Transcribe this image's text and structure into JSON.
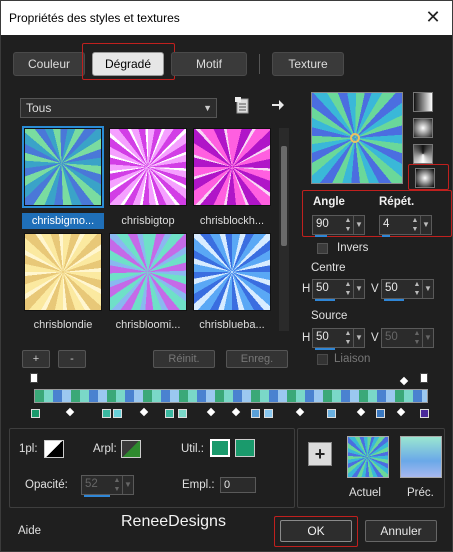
{
  "window": {
    "title": "Propriétés des styles et textures",
    "close_glyph": "✕"
  },
  "tabs": [
    {
      "label": "Couleur",
      "active": false
    },
    {
      "label": "Dégradé",
      "active": true
    },
    {
      "label": "Motif",
      "active": false
    },
    {
      "label": "Texture",
      "active": false
    }
  ],
  "library": {
    "category_selected": "Tous",
    "thumbnails": [
      {
        "label": "chrisbigmo...",
        "selected": true
      },
      {
        "label": "chrisbigtop",
        "selected": false
      },
      {
        "label": "chrisblockh...",
        "selected": false
      },
      {
        "label": "chrisblondie",
        "selected": false
      },
      {
        "label": "chrisbloomi...",
        "selected": false
      },
      {
        "label": "chrisblueba...",
        "selected": false
      }
    ],
    "buttons": {
      "add": "+",
      "remove": "-",
      "reset": "Réinit.",
      "save": "Enreg."
    }
  },
  "style": {
    "angle_label": "Angle",
    "angle_value": "90",
    "repeat_label": "Répét.",
    "repeat_value": "4",
    "invert_label": "Invers",
    "center_label": "Centre",
    "center_h_label": "H",
    "center_h_value": "50",
    "center_v_label": "V",
    "center_v_value": "50",
    "source_label": "Source",
    "source_h_label": "H",
    "source_h_value": "50",
    "source_v_label": "V",
    "source_v_value": "50",
    "link_label": "Liaison"
  },
  "bottom": {
    "fg_label": "1pl:",
    "bg_label": "Arpl:",
    "user_label": "Util.:",
    "opacity_label": "Opacité:",
    "opacity_value": "52",
    "position_label": "Empl.:",
    "position_value": "0",
    "add_preset_glyph": "+",
    "current_label": "Actuel",
    "previous_label": "Préc."
  },
  "footer": {
    "help": "Aide",
    "watermark": "ReneeDesigns",
    "ok": "OK",
    "cancel": "Annuler"
  },
  "colors": {
    "accent_red": "#c0201e",
    "selection_blue": "#1f6fb8",
    "user_green": "#1a9a6c"
  }
}
